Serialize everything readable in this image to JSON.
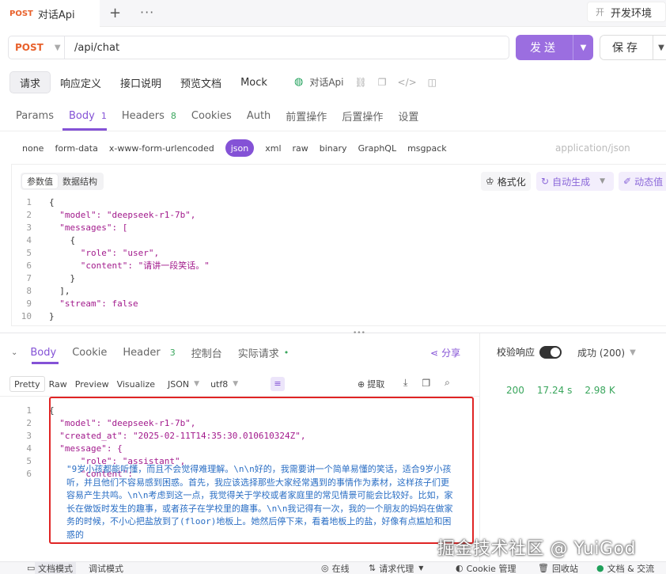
{
  "tab": {
    "method": "POST",
    "title": "对话Api"
  },
  "env": {
    "label": "开发环境"
  },
  "request": {
    "method": "POST",
    "url": "/api/chat",
    "send_label": "发送",
    "save_label": "保存"
  },
  "modes": [
    "请求",
    "响应定义",
    "接口说明",
    "预览文档",
    "Mock"
  ],
  "doc_name": "对话Api",
  "req_tabs": [
    {
      "label": "Params",
      "count": ""
    },
    {
      "label": "Body",
      "count": "1"
    },
    {
      "label": "Headers",
      "count": "8"
    },
    {
      "label": "Cookies",
      "count": ""
    },
    {
      "label": "Auth",
      "count": ""
    },
    {
      "label": "前置操作",
      "count": ""
    },
    {
      "label": "后置操作",
      "count": ""
    },
    {
      "label": "设置",
      "count": ""
    }
  ],
  "body_types": [
    "none",
    "form-data",
    "x-www-form-urlencoded",
    "json",
    "xml",
    "raw",
    "binary",
    "GraphQL",
    "msgpack"
  ],
  "content_type": "application/json",
  "editor": {
    "seg_values": "参数值",
    "seg_schema": "数据结构",
    "format": "格式化",
    "auto_gen": "自动生成",
    "dynamic": "动态值"
  },
  "request_body_lines": [
    {
      "n": "1",
      "text": "{"
    },
    {
      "n": "2",
      "text": "  \"model\": \"deepseek-r1-7b\","
    },
    {
      "n": "3",
      "text": "  \"messages\": ["
    },
    {
      "n": "4",
      "text": "    {"
    },
    {
      "n": "5",
      "text": "      \"role\": \"user\","
    },
    {
      "n": "6",
      "text": "      \"content\": \"请讲一段笑话。\""
    },
    {
      "n": "7",
      "text": "    }"
    },
    {
      "n": "8",
      "text": "  ],"
    },
    {
      "n": "9",
      "text": "  \"stream\": false"
    },
    {
      "n": "10",
      "text": "}"
    }
  ],
  "resp_tabs": [
    {
      "label": "Body",
      "count": ""
    },
    {
      "label": "Cookie",
      "count": ""
    },
    {
      "label": "Header",
      "count": "3"
    },
    {
      "label": "控制台",
      "count": ""
    },
    {
      "label": "实际请求",
      "count": "•"
    }
  ],
  "share": "分享",
  "verify_label": "校验响应",
  "status_select": "成功 (200)",
  "stats": {
    "code": "200",
    "time": "17.24 s",
    "size": "2.98 K"
  },
  "resp_tools": [
    "Pretty",
    "Raw",
    "Preview",
    "Visualize",
    "JSON",
    "utf8"
  ],
  "extract": "提取",
  "response_lines": [
    {
      "n": "1",
      "text": "{"
    },
    {
      "n": "2",
      "text": "  \"model\": \"deepseek-r1-7b\","
    },
    {
      "n": "3",
      "text": "  \"created_at\": \"2025-02-11T14:35:30.010610324Z\","
    },
    {
      "n": "4",
      "text": "  \"message\": {"
    },
    {
      "n": "5",
      "text": "      \"role\": \"assistant\","
    },
    {
      "n": "6",
      "text": "      \"content\": "
    }
  ],
  "response_content": "\"9岁小孩都能听懂，而且不会觉得难理解。\\n\\n好的，我需要讲一个简单易懂的笑话，适合9岁小孩听，并且他们不容易感到困惑。首先，我应该选择那些大家经常遇到的事情作为素材，这样孩子们更容易产生共鸣。\\n\\n考虑到这一点，我觉得关于学校或者家庭里的常见情景可能会比较好。比如，家长在做饭时发生的趣事，或者孩子在学校里的趣事。\\n\\n我记得有一次，我的一个朋友的妈妈在做家务的时候，不小心把盐放到了(floor)地板上。她然后停下来，看着地板上的盐，好像有点尴尬和困惑的",
  "watermark": "掘金技术社区 @ YuiGod",
  "statusbar": [
    "文档模式",
    "调试模式",
    "在线",
    "请求代理",
    "Cookie 管理",
    "回收站",
    "文档 & 交流"
  ]
}
